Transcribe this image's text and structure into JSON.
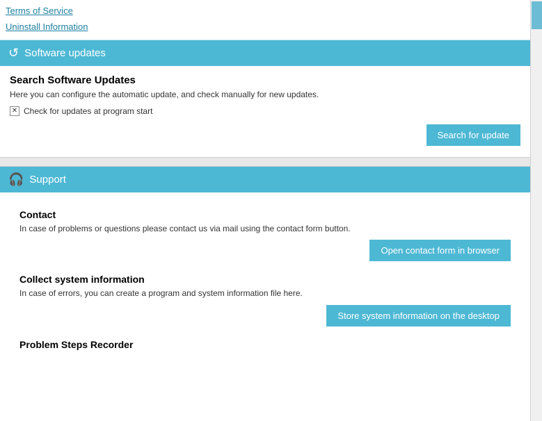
{
  "topLinks": [
    {
      "label": "Terms of Service",
      "id": "terms-of-service"
    },
    {
      "label": "Uninstall Information",
      "id": "uninstall-information"
    }
  ],
  "softwareUpdates": {
    "sectionTitle": "Software updates",
    "icon": "↺",
    "title": "Search Software Updates",
    "description": "Here you can configure the automatic update, and check manually for new updates.",
    "checkboxLabel": "Check for updates at program start",
    "checkboxChecked": true,
    "checkboxIcon": "✕",
    "buttonLabel": "Search for update"
  },
  "support": {
    "sectionTitle": "Support",
    "icon": "🎧",
    "contact": {
      "title": "Contact",
      "description": "In case of problems or questions please contact us via mail using the contact form button.",
      "buttonLabel": "Open contact form in browser"
    },
    "systemInfo": {
      "title": "Collect system information",
      "description": "In case of errors, you can create a program and system information file here.",
      "buttonLabel": "Store system information on the desktop"
    },
    "problemRecorder": {
      "title": "Problem Steps Recorder"
    }
  }
}
